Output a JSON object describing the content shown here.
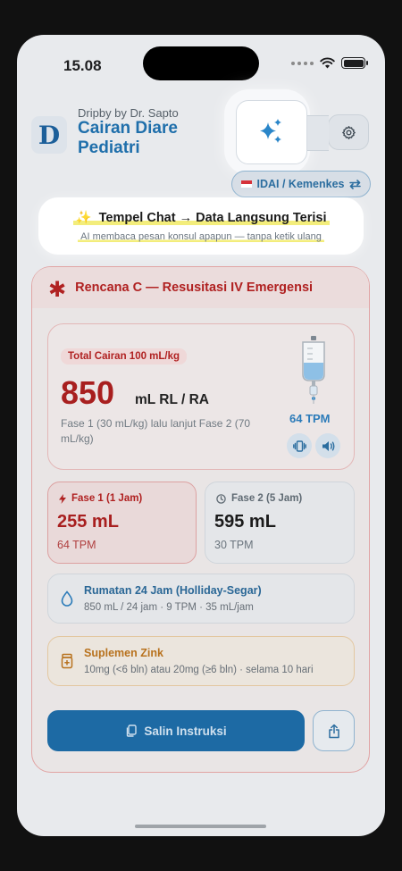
{
  "status_bar": {
    "time": "15.08"
  },
  "header": {
    "logo_letter": "D",
    "brand": "Dripby by Dr. Sapto",
    "title": "Cairan Diare Pediatri",
    "sparkle_icon": "sparkles-icon",
    "settings_icon": "gear-icon",
    "region_pill": "IDAI / Kemenkes",
    "region_icon": "swap-arrows-icon",
    "accent_color": "#1f6fab"
  },
  "paste_banner": {
    "emoji": "✨",
    "title": "Tempel Chat → Data Langsung Terisi",
    "subtitle": "AI membaca pesan konsul apapun — tanpa ketik ulang"
  },
  "plan": {
    "title": "Rencana C — Resusitasi IV Emergensi",
    "danger_color": "#b02121",
    "total_badge": "Total Cairan 100 mL/kg",
    "total_volume": "850",
    "total_unit": "mL RL / RA",
    "description": "Fase 1 (30 mL/kg) lalu lanjut Fase 2 (70 mL/kg)",
    "main_tpm": "64 TPM",
    "phase1": {
      "label": "Fase 1 (1 Jam)",
      "volume": "255 mL",
      "tpm": "64 TPM"
    },
    "phase2": {
      "label": "Fase 2 (5 Jam)",
      "volume": "595 mL",
      "tpm": "30 TPM"
    },
    "maintenance": {
      "title": "Rumatan 24 Jam (Holliday-Segar)",
      "detail": "850 mL / 24 jam  ·  9 TPM  ·  35 mL/jam"
    },
    "zinc": {
      "title": "Suplemen Zink",
      "detail": "10mg (<6 bln) atau 20mg (≥6 bln)  ·  selama 10 hari"
    },
    "copy_button": "Salin Instruksi"
  }
}
